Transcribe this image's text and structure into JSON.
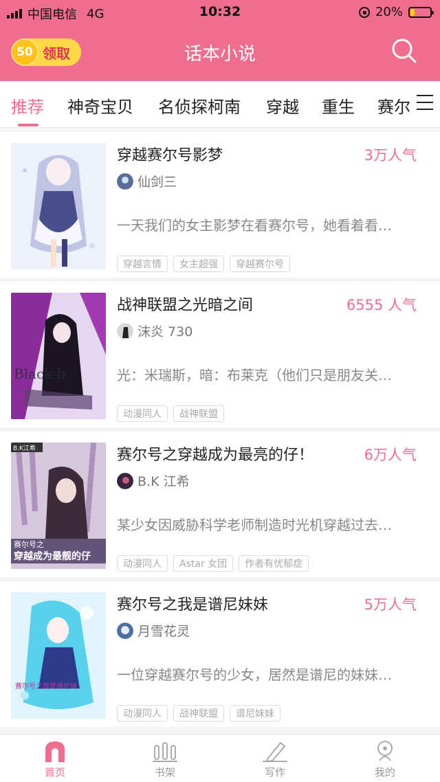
{
  "status_bar": {
    "carrier": "中国电信",
    "network": "4G",
    "time": "10:32",
    "battery": "20%"
  },
  "header": {
    "coin_value": "50",
    "coin_label": "领取",
    "title": "话本小说",
    "search_icon": "search-icon"
  },
  "tabs": [
    {
      "label": "推荐",
      "active": true
    },
    {
      "label": "神奇宝贝"
    },
    {
      "label": "名侦探柯南"
    },
    {
      "label": "穿越"
    },
    {
      "label": "重生"
    },
    {
      "label": "赛尔"
    }
  ],
  "books": [
    {
      "title": "穿越赛尔号影梦",
      "popularity": "3万人气",
      "author": "仙剑三",
      "description": "一天我们的女主影梦在看赛尔号，她看着看…",
      "tags": [
        "穿越言情",
        "女主超强",
        "穿越赛尔号"
      ]
    },
    {
      "title": "战神联盟之光暗之间",
      "popularity": "6555 人气",
      "author": "沫炎 730",
      "description": "光：米瑞斯，暗：布莱克（他们只是朋友关…",
      "tags": [
        "动漫同人",
        "战神联盟"
      ]
    },
    {
      "title": "赛尔号之穿越成为最亮的仔！",
      "popularity": "6万人气",
      "author": "B.K 江希",
      "description": "某少女因威胁科学老师制造时光机穿越过去…",
      "tags": [
        "动漫同人",
        "Astar 女团",
        "作者有忧郁症"
      ]
    },
    {
      "title": "赛尔号之我是谱尼妹妹",
      "popularity": "5万人气",
      "author": "月雪花灵",
      "description": "一位穿越赛尔号的少女，居然是谱尼的妹妹…",
      "tags": [
        "动漫同人",
        "战神联盟",
        "谱尼妹妹"
      ]
    }
  ],
  "bottom_nav": [
    {
      "label": "首页",
      "icon": "home-icon",
      "active": true
    },
    {
      "label": "书架",
      "icon": "bookshelf-icon"
    },
    {
      "label": "写作",
      "icon": "pencil-icon"
    },
    {
      "label": "我的",
      "icon": "profile-icon"
    }
  ],
  "colors": {
    "brand": "#ef6d8e",
    "coin": "#ffd84a"
  }
}
